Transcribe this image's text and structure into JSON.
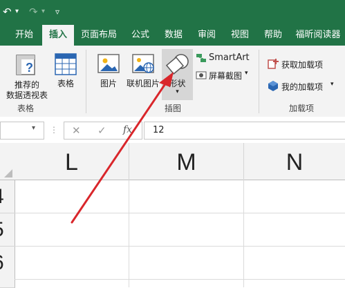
{
  "titlebar": {
    "undo": "↶",
    "undo_drop": "▾",
    "redo": "↷",
    "redo_drop": "▾",
    "customize": "▿"
  },
  "tabs": [
    "开始",
    "插入",
    "页面布局",
    "公式",
    "数据",
    "审阅",
    "视图",
    "帮助",
    "福昕阅读器"
  ],
  "active_tab": "插入",
  "ribbon": {
    "tables_group": {
      "label": "表格",
      "recommended_pivot_line1": "推荐的",
      "recommended_pivot_line2": "数据透视表",
      "table": "表格"
    },
    "illustrations_group": {
      "label": "插图",
      "picture": "图片",
      "online_picture": "联机图片",
      "shapes": "形状",
      "shapes_drop": "▾",
      "smartart": "SmartArt",
      "screenshot": "屏幕截图",
      "screenshot_drop": "▾"
    },
    "addins_group": {
      "label": "加载项",
      "get_addins": "获取加载项",
      "my_addins": "我的加载项",
      "my_addins_drop": "▾"
    }
  },
  "formula_bar": {
    "name_box": "",
    "name_drop": "▾",
    "cancel": "✕",
    "enter": "✓",
    "fx": "fx",
    "value": "12"
  },
  "columns": [
    "L",
    "M",
    "N"
  ],
  "rows": [
    "4",
    "5",
    "6"
  ],
  "colors": {
    "accent": "#217346",
    "arrow": "#d9262b"
  }
}
